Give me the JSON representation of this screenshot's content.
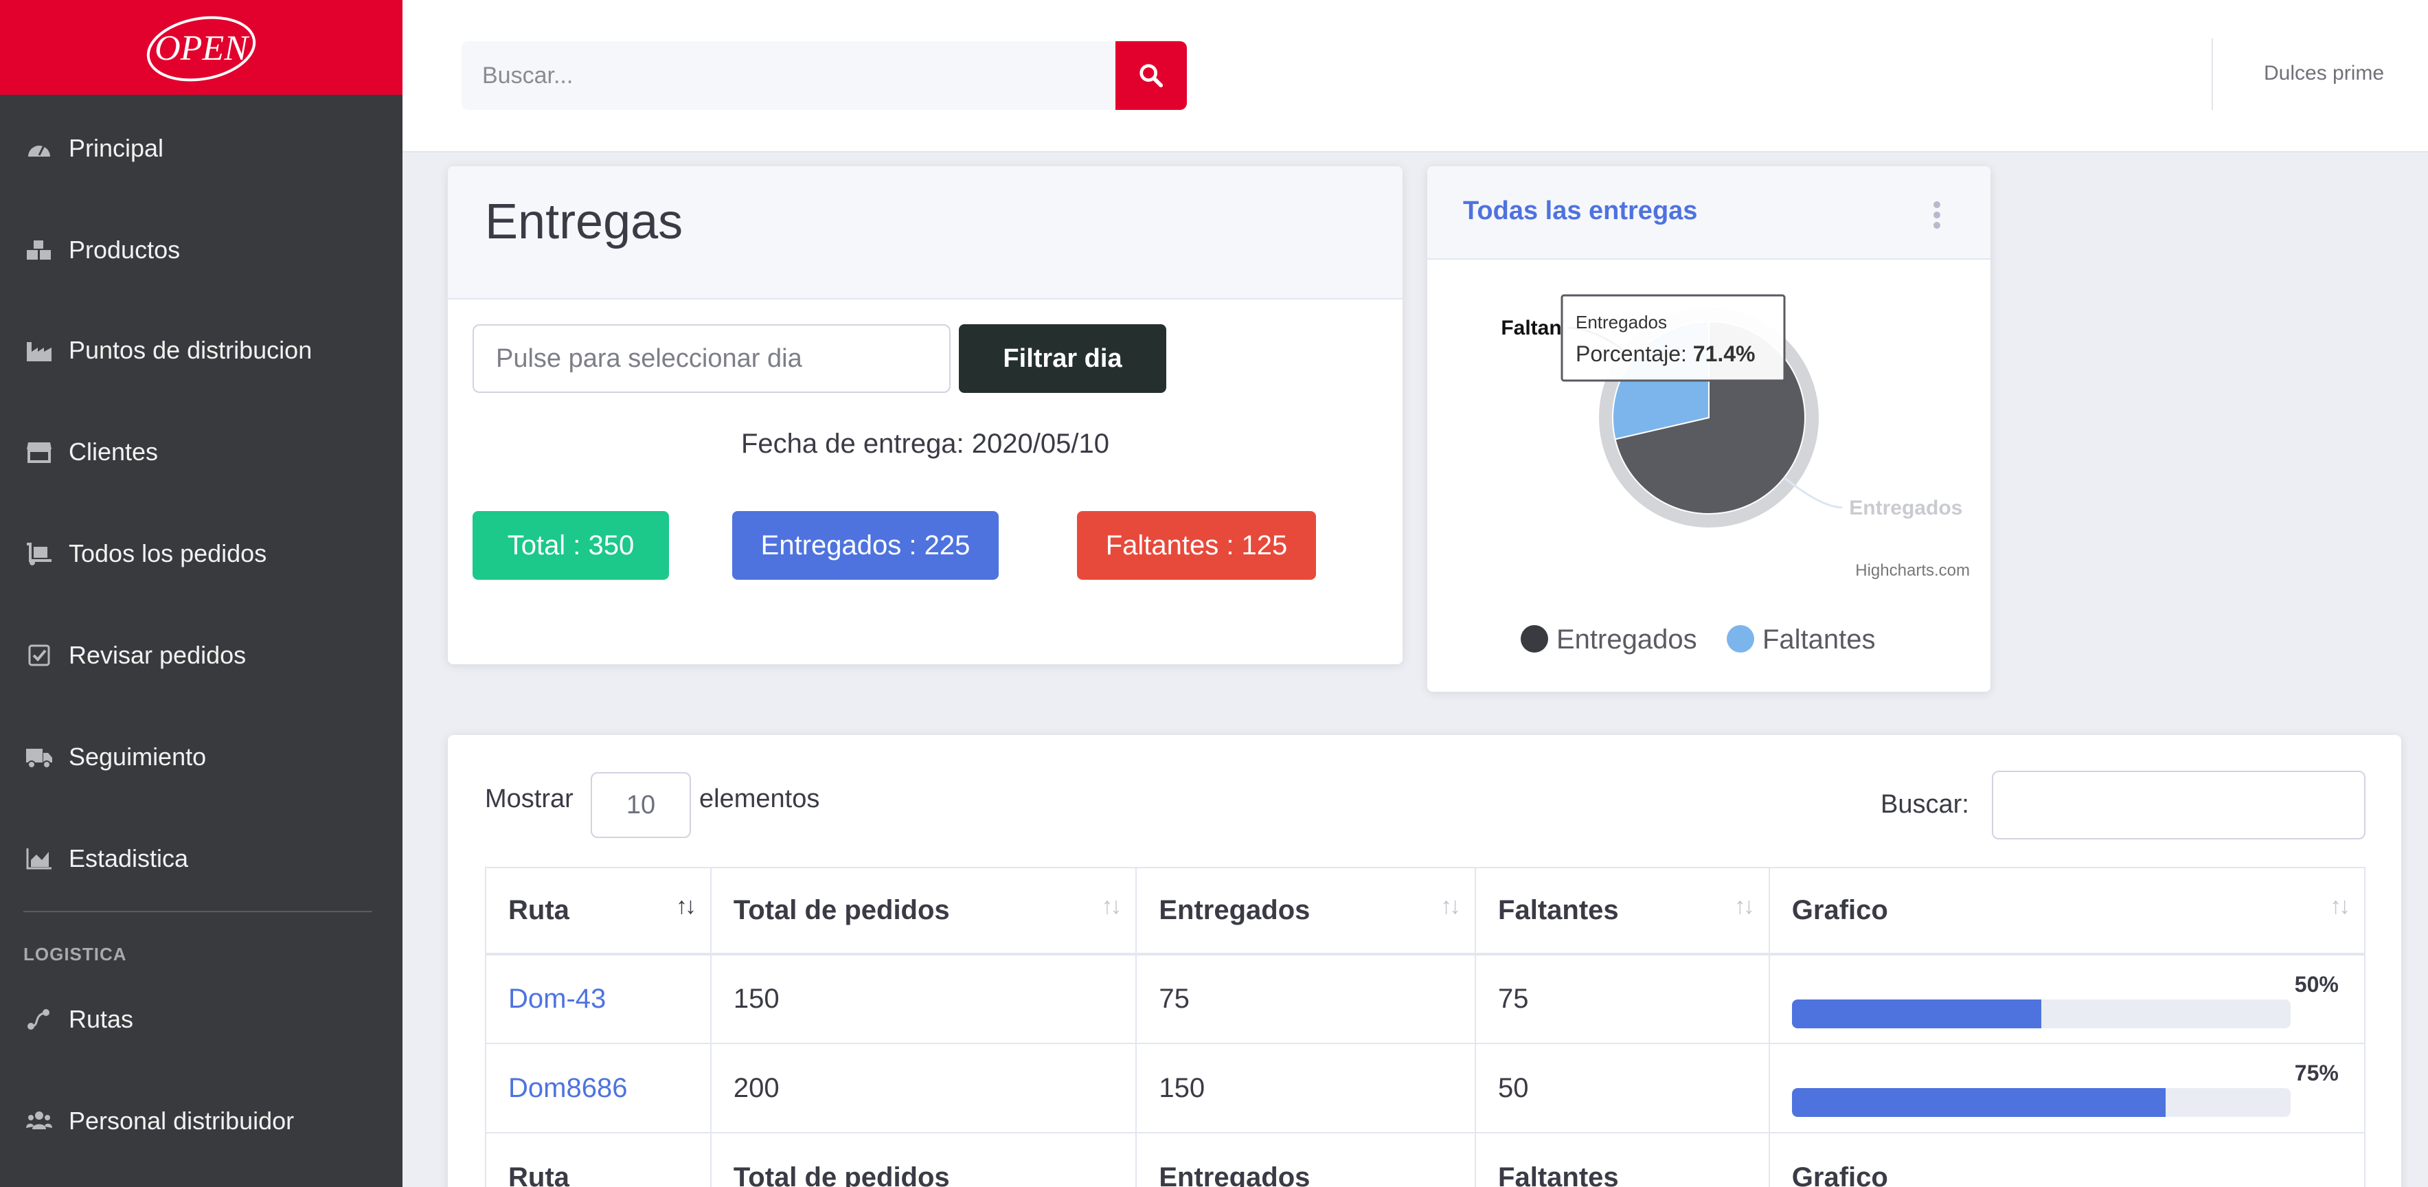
{
  "brand": {
    "logo_text": "OPEN",
    "color": "#e2002d"
  },
  "sidebar": {
    "items": [
      {
        "label": "Principal",
        "icon": "dashboard-icon"
      },
      {
        "label": "Productos",
        "icon": "boxes-icon"
      },
      {
        "label": "Puntos de distribucion",
        "icon": "industry-icon"
      },
      {
        "label": "Clientes",
        "icon": "store-icon"
      },
      {
        "label": "Todos los pedidos",
        "icon": "dolly-icon"
      },
      {
        "label": "Revisar pedidos",
        "icon": "check-square-icon"
      },
      {
        "label": "Seguimiento",
        "icon": "truck-icon"
      },
      {
        "label": "Estadistica",
        "icon": "chart-area-icon"
      }
    ],
    "section_heading": "LOGISTICA",
    "section_items": [
      {
        "label": "Rutas",
        "icon": "route-icon"
      },
      {
        "label": "Personal distribuidor",
        "icon": "users-icon"
      }
    ]
  },
  "topbar": {
    "search_placeholder": "Buscar...",
    "user_name": "Dulces prime"
  },
  "entregas": {
    "title": "Entregas",
    "date_placeholder": "Pulse para seleccionar dia",
    "filter_label": "Filtrar dia",
    "fecha_label": "Fecha de entrega: 2020/05/10",
    "total_label": "Total :  350",
    "entregados_label": "Entregados : 225",
    "faltantes_label": "Faltantes : 125"
  },
  "pie_card": {
    "title": "Todas las entregas",
    "tooltip_series": "Entregados",
    "tooltip_value_label": "Porcentaje:",
    "tooltip_value": "71.4%",
    "credits": "Highcharts.com"
  },
  "chart_data": {
    "type": "pie",
    "title": "Todas las entregas",
    "series": [
      {
        "name": "Porcentaje",
        "data": [
          {
            "name": "Entregados",
            "value": 71.4,
            "color": "#5a5b60",
            "data_label": "Entregados"
          },
          {
            "name": "Faltantes",
            "value": 28.6,
            "color": "#7cb5ec",
            "data_label": "Faltan"
          }
        ]
      }
    ],
    "legend": [
      "Entregados",
      "Faltantes"
    ],
    "legend_position": "bottom"
  },
  "table": {
    "mostrar_label": "Mostrar",
    "length_value": "10",
    "elementos_label": "elementos",
    "buscar_label": "Buscar:",
    "columns": [
      "Ruta",
      "Total de pedidos",
      "Entregados",
      "Faltantes",
      "Grafico"
    ],
    "rows": [
      {
        "ruta": "Dom-43",
        "total": "150",
        "entregados": "75",
        "faltantes": "75",
        "progress": 50,
        "progress_label": "50%"
      },
      {
        "ruta": "Dom8686",
        "total": "200",
        "entregados": "150",
        "faltantes": "50",
        "progress": 75,
        "progress_label": "75%"
      }
    ]
  }
}
